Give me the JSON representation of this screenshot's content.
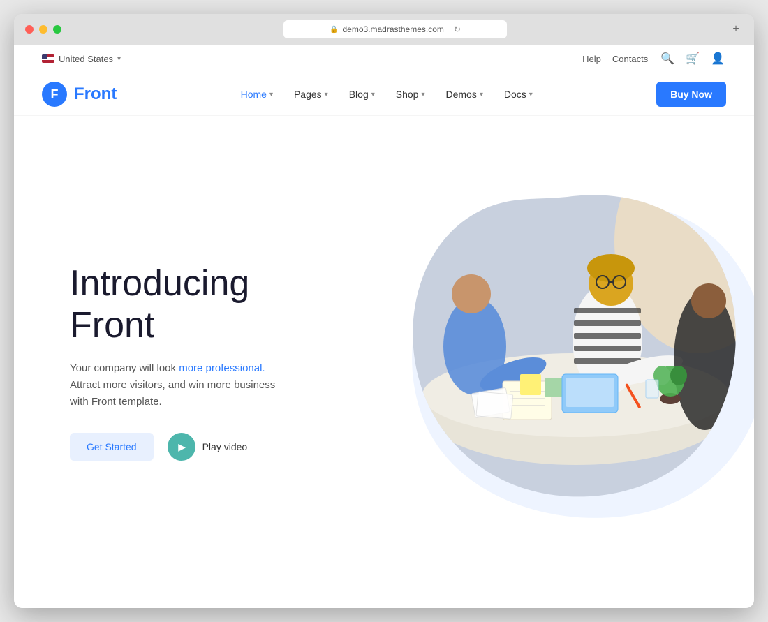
{
  "browser": {
    "address": "demo3.madrasthemes.com",
    "new_tab_label": "+"
  },
  "topbar": {
    "locale": "United States",
    "help_label": "Help",
    "contacts_label": "Contacts"
  },
  "nav": {
    "logo_letter": "F",
    "logo_name": "Front",
    "menu_items": [
      {
        "label": "Home",
        "has_dropdown": true,
        "active": true
      },
      {
        "label": "Pages",
        "has_dropdown": true,
        "active": false
      },
      {
        "label": "Blog",
        "has_dropdown": true,
        "active": false
      },
      {
        "label": "Shop",
        "has_dropdown": true,
        "active": false
      },
      {
        "label": "Demos",
        "has_dropdown": true,
        "active": false
      },
      {
        "label": "Docs",
        "has_dropdown": true,
        "active": false
      }
    ],
    "buy_btn_label": "Buy Now"
  },
  "hero": {
    "title_line1": "Introducing",
    "title_line2": "Front",
    "description_prefix": "Your company will look ",
    "description_highlight": "more professional.",
    "description_suffix": "Attract more visitors, and win more business with Front template.",
    "get_started_label": "Get Started",
    "play_video_label": "Play video"
  },
  "colors": {
    "primary": "#2979ff",
    "teal": "#4db6ac",
    "light_blue_bg": "#e8f4fd"
  }
}
